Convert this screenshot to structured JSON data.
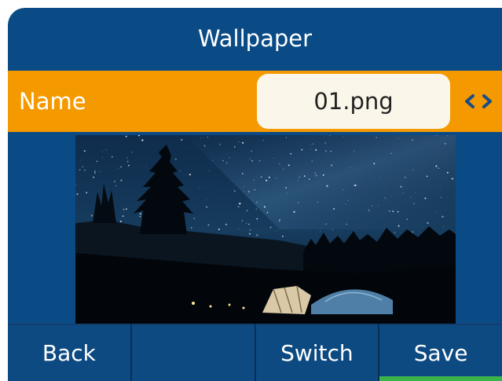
{
  "header": {
    "title": "Wallpaper"
  },
  "name_field": {
    "label": "Name",
    "value": "01.png",
    "arrows": "‹›"
  },
  "preview": {
    "image": "starry-night-wallpaper"
  },
  "softkeys": [
    {
      "label": "Back"
    },
    {
      "label": ""
    },
    {
      "label": "Switch"
    },
    {
      "label": "Save"
    }
  ],
  "colors": {
    "screen_bg": "#0a4b86",
    "selected_row": "#f49a00",
    "softkey_active_bar": "#3bb44a"
  }
}
